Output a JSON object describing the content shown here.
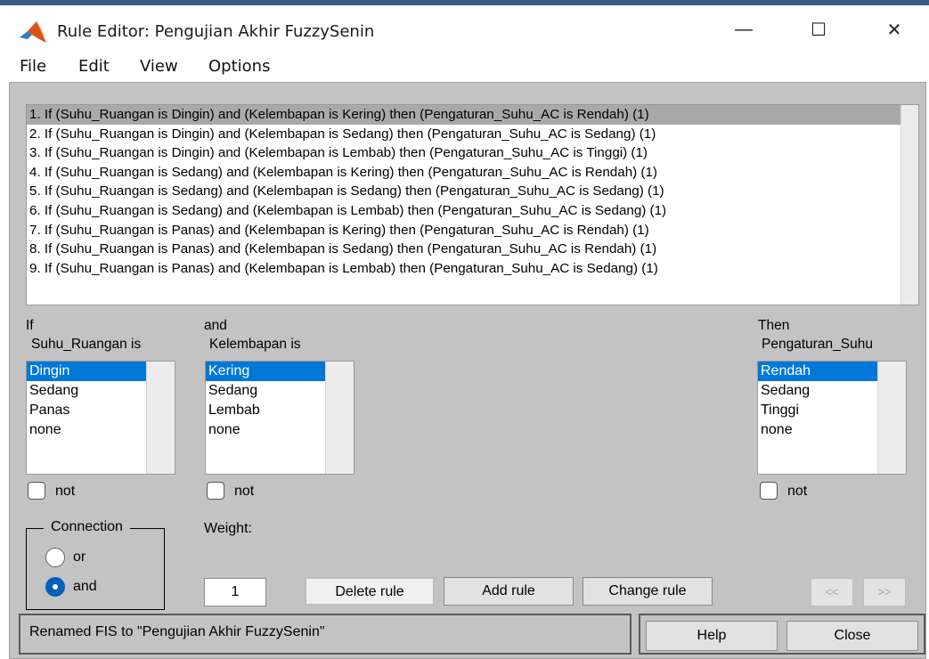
{
  "window": {
    "title": "Rule Editor: Pengujian Akhir FuzzySenin",
    "minimize_glyph": "—",
    "maximize_glyph": "☐",
    "close_glyph": "✕",
    "app_icon": "matlab-logo-icon"
  },
  "menu": [
    "File",
    "Edit",
    "View",
    "Options"
  ],
  "rules": [
    "1. If (Suhu_Ruangan is Dingin) and (Kelembapan is Kering) then (Pengaturan_Suhu_AC is Rendah) (1)",
    "2. If (Suhu_Ruangan is Dingin) and (Kelembapan is Sedang) then (Pengaturan_Suhu_AC is Sedang) (1)",
    "3. If (Suhu_Ruangan is Dingin) and (Kelembapan is Lembab) then (Pengaturan_Suhu_AC is Tinggi) (1)",
    "4. If (Suhu_Ruangan is Sedang) and (Kelembapan is Kering) then (Pengaturan_Suhu_AC is Rendah) (1)",
    "5. If (Suhu_Ruangan is Sedang) and (Kelembapan is Sedang) then (Pengaturan_Suhu_AC is Sedang) (1)",
    "6. If (Suhu_Ruangan is Sedang) and (Kelembapan is Lembab) then (Pengaturan_Suhu_AC is Sedang) (1)",
    "7. If (Suhu_Ruangan is Panas) and (Kelembapan is Kering) then (Pengaturan_Suhu_AC is Rendah) (1)",
    "8. If (Suhu_Ruangan is Panas) and (Kelembapan is Sedang) then (Pengaturan_Suhu_AC is Rendah) (1)",
    "9. If (Suhu_Ruangan is Panas) and (Kelembapan is Lembab) then (Pengaturan_Suhu_AC is Sedang) (1)"
  ],
  "selected_rule_index": 0,
  "if_panel": {
    "label": "If",
    "variable_label": "Suhu_Ruangan is",
    "options": [
      "Dingin",
      "Sedang",
      "Panas",
      "none"
    ],
    "selected": 0,
    "not_label": "not"
  },
  "and_panel": {
    "label": "and",
    "variable_label": "Kelembapan is",
    "options": [
      "Kering",
      "Sedang",
      "Lembab",
      "none"
    ],
    "selected": 0,
    "not_label": "not"
  },
  "then_panel": {
    "label": "Then",
    "variable_label": "Pengaturan_Suhu",
    "options": [
      "Rendah",
      "Sedang",
      "Tinggi",
      "none"
    ],
    "selected": 0,
    "not_label": "not"
  },
  "connection": {
    "label": "Connection",
    "or_label": "or",
    "and_label": "and",
    "selected": "and"
  },
  "weight": {
    "label": "Weight:",
    "value": "1"
  },
  "buttons": {
    "delete_rule": "Delete rule",
    "add_rule": "Add rule",
    "change_rule": "Change rule",
    "prev": "<<",
    "next": ">>",
    "help": "Help",
    "close": "Close"
  },
  "status": "Renamed FIS to \"Pengujian Akhir FuzzySenin\"",
  "colors": {
    "figure_bg": "#c3c3c3",
    "selection_blue": "#0078d7",
    "selected_rule_bg": "#a9a9a9"
  }
}
